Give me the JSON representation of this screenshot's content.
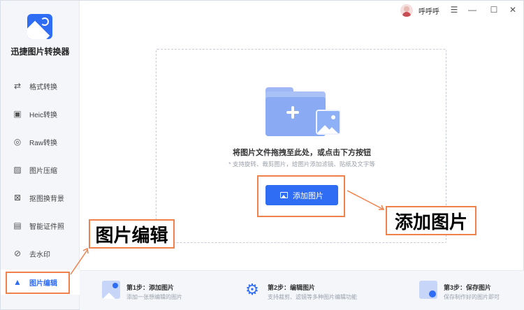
{
  "app": {
    "title": "迅捷图片转换器"
  },
  "titlebar": {
    "username": "呼呼呼",
    "menu_icon": "menu-icon",
    "min_icon": "minimize-icon",
    "max_icon": "maximize-icon",
    "close_icon": "close-icon"
  },
  "sidebar": {
    "items": [
      {
        "label": "格式转换",
        "icon": "format-convert-icon"
      },
      {
        "label": "Heic转换",
        "icon": "heic-icon"
      },
      {
        "label": "Raw转换",
        "icon": "raw-icon"
      },
      {
        "label": "图片压缩",
        "icon": "compress-icon"
      },
      {
        "label": "抠图换背景",
        "icon": "cutout-icon"
      },
      {
        "label": "智能证件照",
        "icon": "id-photo-icon"
      },
      {
        "label": "去水印",
        "icon": "watermark-icon"
      },
      {
        "label": "图片编辑",
        "icon": "image-edit-icon",
        "active": true
      }
    ]
  },
  "dropzone": {
    "main_text": "将图片文件拖拽至此处，或点击下方按钮",
    "hint": "* 支持旋转、裁剪图片，给图片添加滤镜、贴纸及文字等",
    "button_label": "添加图片"
  },
  "callouts": {
    "sidebar": "图片编辑",
    "button": "添加图片"
  },
  "steps": [
    {
      "title": "第1步：添加图片",
      "desc": "添加一张想编辑的图片"
    },
    {
      "title": "第2步：编辑图片",
      "desc": "支持裁剪、滤镜等多种图片编辑功能"
    },
    {
      "title": "第3步：保存图片",
      "desc": "保存制作好的图片即可"
    }
  ],
  "colors": {
    "accent": "#2f6df5",
    "highlight": "#f0814a",
    "sidebar_bg": "#f4f6fa"
  }
}
